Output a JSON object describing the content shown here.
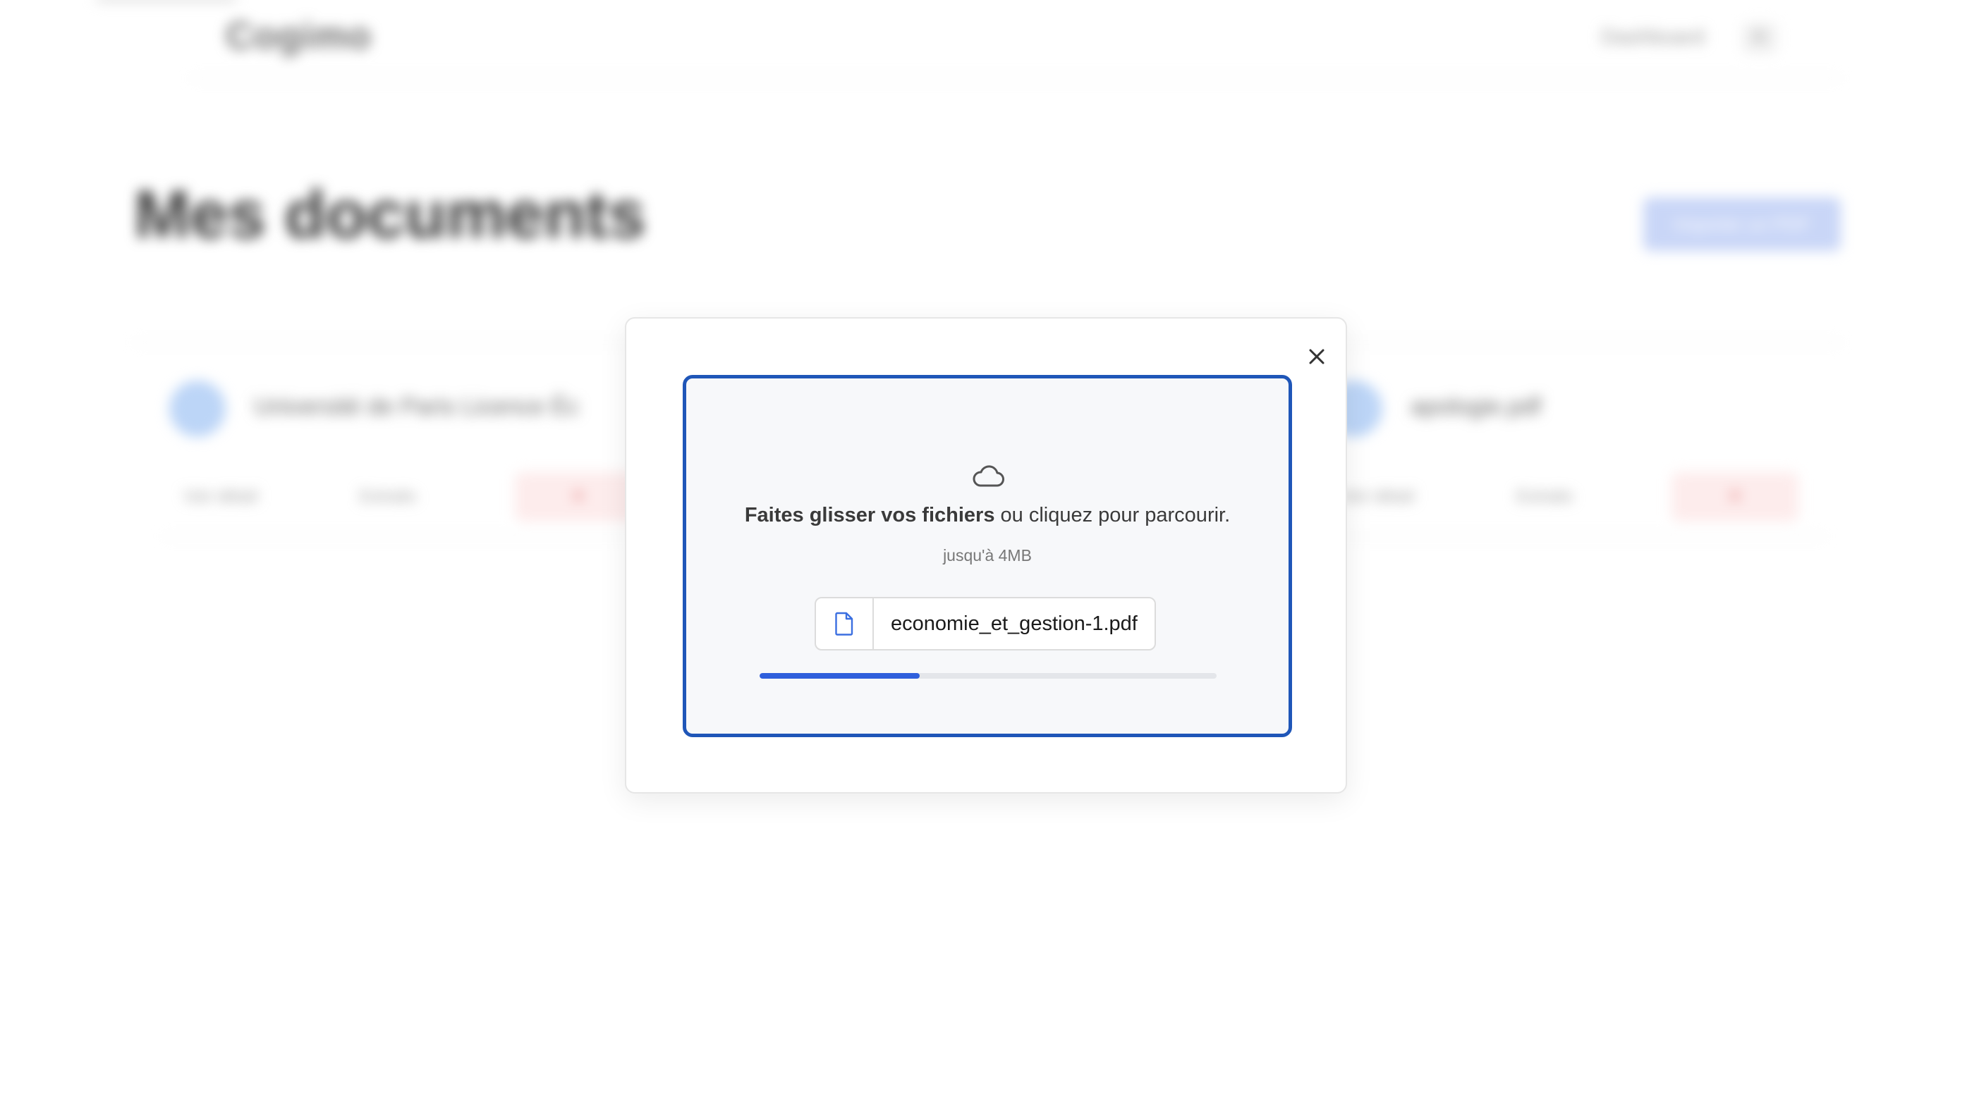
{
  "app": {
    "brand": "Cogimo",
    "nav_link": "Dashboard",
    "avatar_initial": "R"
  },
  "page": {
    "title": "Mes documents",
    "primary_button": "Importer un PDF"
  },
  "documents": [
    {
      "title": "Université de Paris Licence Éc",
      "actions": [
        "Voir détail",
        "Extraits",
        "✕"
      ]
    },
    {
      "title": "apologie.pdf",
      "actions": [
        "Voir détail",
        "Extraits",
        "✕"
      ]
    }
  ],
  "modal": {
    "close_icon": "close-icon",
    "dropzone": {
      "icon": "cloud-icon",
      "instruction_strong": "Faites glisser vos fichiers",
      "instruction_rest": " ou cliquez pour parcourir.",
      "limit": "jusqu'à 4MB"
    },
    "file": {
      "icon": "file-icon",
      "name": "economie_et_gestion-1.pdf"
    },
    "upload_progress": 0.35
  },
  "colors": {
    "accent": "#1f56b8",
    "progress": "#2f5fdc",
    "track": "#e4e6ea",
    "file_icon": "#3b6fe0"
  }
}
